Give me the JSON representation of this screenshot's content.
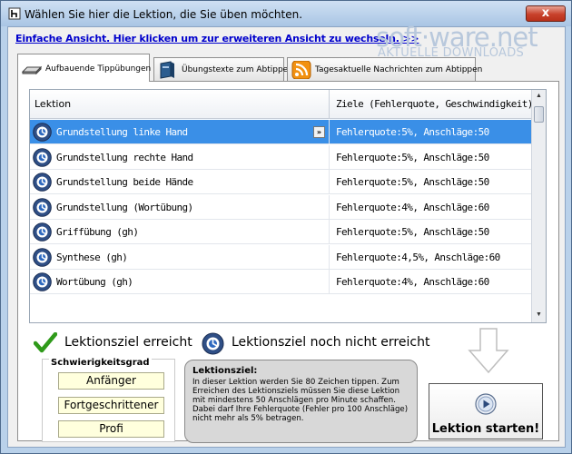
{
  "window": {
    "title": "Wählen Sie hier die Lektion, die Sie üben möchten.",
    "close_label": "x"
  },
  "simple_view_link": "Einfache Ansicht. Hier klicken um zur erweiteren Ansicht zu wechseln. >>",
  "watermark": {
    "main": "soft·ware.net",
    "sub": "AKTUELLE DOWNLOADS"
  },
  "tabs": [
    {
      "label": "Aufbauende Tippübungen",
      "icon": "keyboard-icon",
      "active": true
    },
    {
      "label": "Übungstexte zum Abtippen",
      "icon": "book-icon",
      "active": false
    },
    {
      "label": "Tagesaktuelle Nachrichten zum Abtippen",
      "icon": "rss-icon",
      "active": false
    }
  ],
  "grid": {
    "columns": [
      "Lektion",
      "Ziele (Fehlerquote, Geschwindigkeit)"
    ],
    "rows": [
      {
        "lesson": "Grundstellung linke Hand",
        "goal": "Fehlerquote:5%, Anschläge:50",
        "selected": true
      },
      {
        "lesson": "Grundstellung rechte Hand",
        "goal": "Fehlerquote:5%, Anschläge:50",
        "selected": false
      },
      {
        "lesson": "Grundstellung beide Hände",
        "goal": "Fehlerquote:5%, Anschläge:50",
        "selected": false
      },
      {
        "lesson": "Grundstellung (Wortübung)",
        "goal": "Fehlerquote:4%, Anschläge:60",
        "selected": false
      },
      {
        "lesson": "Griffübung (gh)",
        "goal": "Fehlerquote:5%, Anschläge:50",
        "selected": false
      },
      {
        "lesson": "Synthese (gh)",
        "goal": "Fehlerquote:4,5%, Anschläge:60",
        "selected": false
      },
      {
        "lesson": "Wortübung (gh)",
        "goal": "Fehlerquote:4%, Anschläge:60",
        "selected": false
      }
    ],
    "expand_label": "»"
  },
  "legend": {
    "reached": "Lektionsziel erreicht",
    "not_reached": "Lektionsziel noch nicht erreicht"
  },
  "difficulty": {
    "title": "Schwierigkeitsgrad",
    "levels": [
      "Anfänger",
      "Fortgeschrittener",
      "Profi"
    ]
  },
  "goal_box": {
    "title": "Lektionsziel:",
    "text": "In dieser Lektion werden Sie 80 Zeichen tippen. Zum Erreichen des Lektionsziels müssen Sie diese Lektion mit mindestens 50 Anschlägen pro Minute schaffen. Dabei darf Ihre Fehlerquote (Fehler pro 100 Anschläge) nicht mehr als 5% betragen."
  },
  "start_button": {
    "label": "Lektion starten!"
  },
  "colors": {
    "selection": "#3a8fe7",
    "link": "#0000cc",
    "check": "#2f9a1a",
    "level_button_bg": "#ffffdd"
  }
}
